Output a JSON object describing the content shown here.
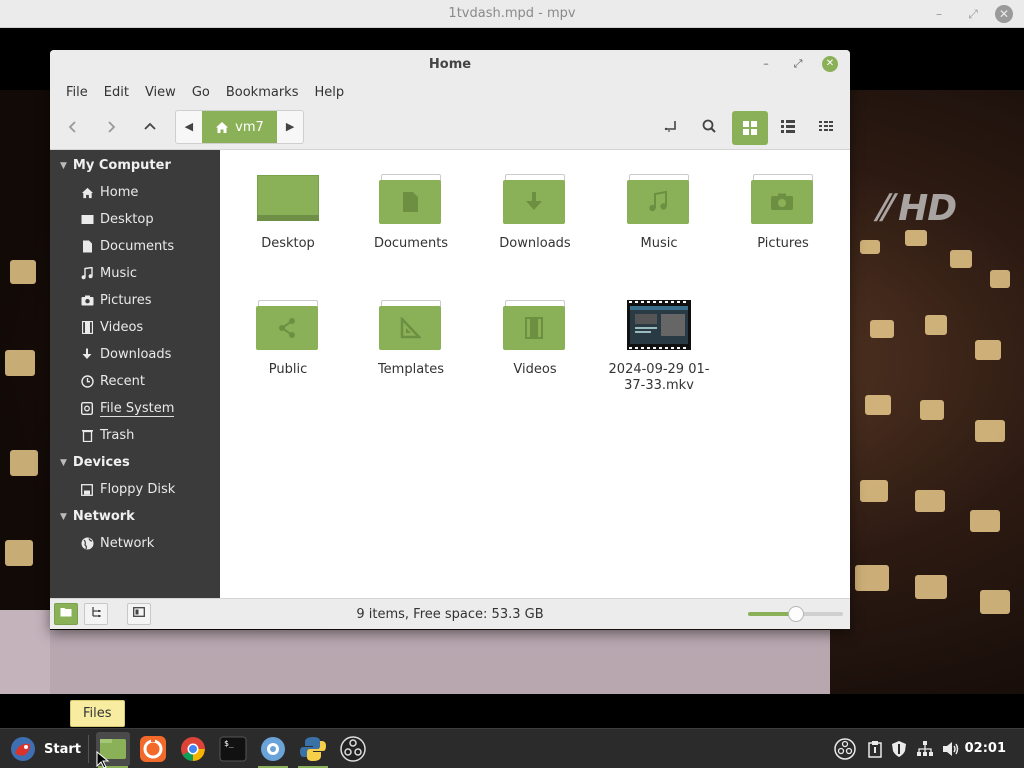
{
  "mpv": {
    "title": "1tvdash.mpd - mpv",
    "channel_logo": "HD"
  },
  "files": {
    "title": "Home",
    "menu": [
      "File",
      "Edit",
      "View",
      "Go",
      "Bookmarks",
      "Help"
    ],
    "path": {
      "current": "vm7"
    },
    "sidebar": {
      "sections": [
        {
          "heading": "My Computer",
          "items": [
            {
              "label": "Home",
              "icon": "home-icon"
            },
            {
              "label": "Desktop",
              "icon": "desktop-icon"
            },
            {
              "label": "Documents",
              "icon": "documents-icon"
            },
            {
              "label": "Music",
              "icon": "music-icon"
            },
            {
              "label": "Pictures",
              "icon": "pictures-icon"
            },
            {
              "label": "Videos",
              "icon": "videos-icon"
            },
            {
              "label": "Downloads",
              "icon": "downloads-icon"
            },
            {
              "label": "Recent",
              "icon": "recent-icon"
            },
            {
              "label": "File System",
              "icon": "filesystem-icon"
            },
            {
              "label": "Trash",
              "icon": "trash-icon"
            }
          ]
        },
        {
          "heading": "Devices",
          "items": [
            {
              "label": "Floppy Disk",
              "icon": "floppy-icon"
            }
          ]
        },
        {
          "heading": "Network",
          "items": [
            {
              "label": "Network",
              "icon": "network-icon"
            }
          ]
        }
      ]
    },
    "items": [
      {
        "name": "Desktop",
        "type": "folder-desktop",
        "icon": "desktop-folder-icon"
      },
      {
        "name": "Documents",
        "type": "folder",
        "icon": "documents-folder-icon"
      },
      {
        "name": "Downloads",
        "type": "folder",
        "icon": "downloads-folder-icon"
      },
      {
        "name": "Music",
        "type": "folder",
        "icon": "music-folder-icon"
      },
      {
        "name": "Pictures",
        "type": "folder",
        "icon": "pictures-folder-icon"
      },
      {
        "name": "Public",
        "type": "folder",
        "icon": "public-folder-icon"
      },
      {
        "name": "Templates",
        "type": "folder",
        "icon": "templates-folder-icon"
      },
      {
        "name": "Videos",
        "type": "folder",
        "icon": "videos-folder-icon"
      },
      {
        "name": "2024-09-29 01-37-33.mkv",
        "name_lines": [
          "2024-09-29 01-",
          "37-33.mkv"
        ],
        "type": "video",
        "icon": "video-thumbnail"
      }
    ],
    "status": "9 items, Free space: 53.3 GB",
    "zoom_level": 0.5,
    "accent_color": "#8bb158"
  },
  "tooltip": "Files",
  "taskbar": {
    "start_label": "Start",
    "apps": [
      {
        "name": "files-app",
        "active": true
      },
      {
        "name": "firefox-app",
        "active": false
      },
      {
        "name": "chrome-app",
        "active": false
      },
      {
        "name": "terminal-app",
        "active": false
      },
      {
        "name": "chromium-like-app",
        "active": false
      },
      {
        "name": "python-app",
        "active": false
      },
      {
        "name": "obs-app",
        "active": false
      }
    ],
    "clock": "02:01"
  }
}
